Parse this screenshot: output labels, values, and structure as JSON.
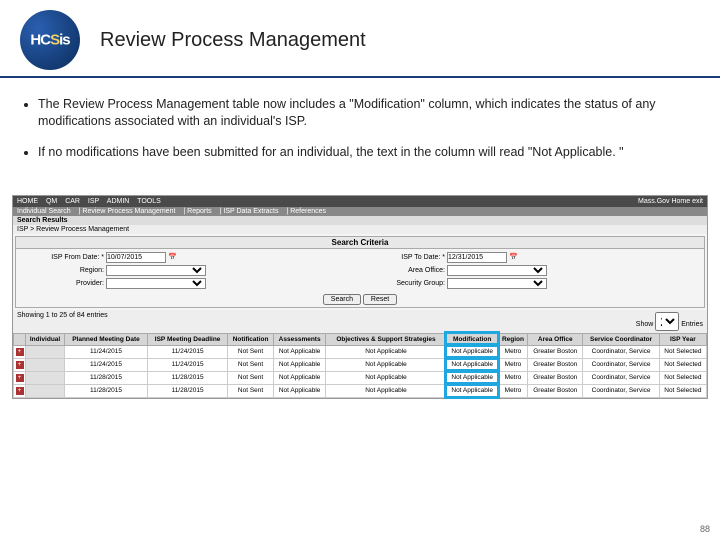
{
  "header": {
    "logo_text_before": "HC",
    "logo_text_s": "S",
    "logo_text_after": "is",
    "title": "Review Process Management"
  },
  "bullets": [
    "The Review Process Management table now includes a \"Modification\" column, which indicates the status of any modifications associated with an individual's ISP.",
    "If no modifications have been submitted for an individual, the text in the column will read \"Not Applicable. \""
  ],
  "nav": {
    "items": [
      "HOME",
      "QM",
      "CAR",
      "ISP",
      "ADMIN",
      "TOOLS"
    ],
    "right": "Mass.Gov Home   exit"
  },
  "subnav": {
    "items": [
      "Individual Search",
      "Review Process Management",
      "Reports",
      "ISP Data Extracts",
      "References"
    ]
  },
  "search_results_label": "Search Results",
  "breadcrumb": "ISP > Review Process Management",
  "criteria": {
    "title": "Search Criteria",
    "isp_from_label": "ISP From Date: *",
    "isp_from_value": "10/07/2015",
    "isp_to_label": "ISP To Date: *",
    "isp_to_value": "12/31/2015",
    "region_label": "Region:",
    "area_office_label": "Area Office:",
    "provider_label": "Provider:",
    "security_group_label": "Security Group:",
    "search_btn": "Search",
    "reset_btn": "Reset"
  },
  "entries": {
    "left": "Showing 1 to 25 of 84 entries",
    "right_prefix": "Show",
    "right_val": "25",
    "right_suffix": "Entries"
  },
  "columns": [
    "",
    "Individual",
    "Planned Meeting Date",
    "ISP Meeting Deadline",
    "Notification",
    "Assessments",
    "Objectives & Support Strategies",
    "Modification",
    "Region",
    "Area Office",
    "Service Coordinator",
    "ISP Year"
  ],
  "rows": [
    {
      "pmd": "11/24/2015",
      "imd": "11/24/2015",
      "notif": "Not Sent",
      "assess": "Not Applicable",
      "obj": "Not Applicable",
      "mod": "Not Applicable",
      "region": "Metro",
      "ao": "Greater Boston",
      "sc": "Coordinator, Service",
      "yr": "Not Selected"
    },
    {
      "pmd": "11/24/2015",
      "imd": "11/24/2015",
      "notif": "Not Sent",
      "assess": "Not Applicable",
      "obj": "Not Applicable",
      "mod": "Not Applicable",
      "region": "Metro",
      "ao": "Greater Boston",
      "sc": "Coordinator, Service",
      "yr": "Not Selected"
    },
    {
      "pmd": "11/28/2015",
      "imd": "11/28/2015",
      "notif": "Not Sent",
      "assess": "Not Applicable",
      "obj": "Not Applicable",
      "mod": "Not Applicable",
      "region": "Metro",
      "ao": "Greater Boston",
      "sc": "Coordinator, Service",
      "yr": "Not Selected"
    },
    {
      "pmd": "11/28/2015",
      "imd": "11/28/2015",
      "notif": "Not Sent",
      "assess": "Not Applicable",
      "obj": "Not Applicable",
      "mod": "Not Applicable",
      "region": "Metro",
      "ao": "Greater Boston",
      "sc": "Coordinator, Service",
      "yr": "Not Selected"
    }
  ],
  "page_number": "88"
}
